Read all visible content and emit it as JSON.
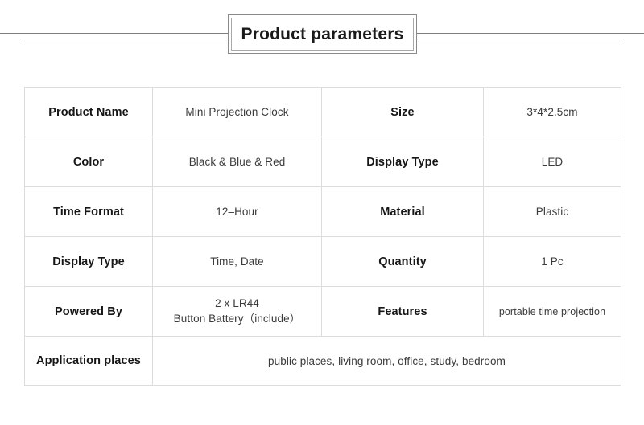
{
  "header": {
    "title": "Product parameters",
    "rule_color": "#7d7d7d",
    "box_border_color": "#8a8a8a"
  },
  "table": {
    "border_color": "#dcdcdc",
    "label_color": "#161616",
    "value_color": "#3b3b3b",
    "rows": [
      {
        "label_left": "Product Name",
        "value_left": "Mini Projection Clock",
        "label_right": "Size",
        "value_right": "3*4*2.5cm"
      },
      {
        "label_left": "Color",
        "value_left": "Black & Blue & Red",
        "label_right": "Display Type",
        "value_right": "LED"
      },
      {
        "label_left": "Time Format",
        "value_left": "12–Hour",
        "label_right": "Material",
        "value_right": "Plastic"
      },
      {
        "label_left": "Display Type",
        "value_left": "Time, Date",
        "label_right": "Quantity",
        "value_right": "1 Pc"
      },
      {
        "label_left": "Powered By",
        "value_left_line1": "2 x LR44",
        "value_left_line2": "Button Battery（include）",
        "label_right": "Features",
        "value_right": "portable time projection"
      }
    ],
    "merged_row": {
      "label": "Application places",
      "value": "public places, living room, office, study, bedroom"
    }
  }
}
